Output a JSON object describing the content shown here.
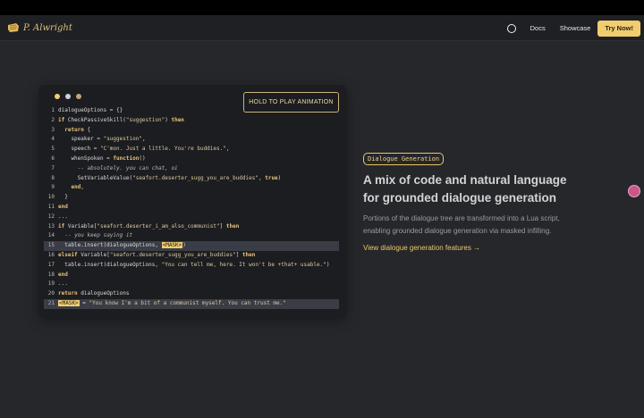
{
  "nav": {
    "logo_text": "P. Alwright",
    "links": [
      "Docs",
      "Showcase"
    ],
    "cta": "Try Now!"
  },
  "demo": {
    "hold_button": "HOLD TO PLAY ANIMATION",
    "dot_colors": [
      "#f1cd6f",
      "#cfd2d8",
      "#c7a27a"
    ],
    "code_lines": [
      {
        "n": "1",
        "segs": [
          {
            "t": "dialogueOptions = {}"
          }
        ]
      },
      {
        "n": "2",
        "segs": [
          {
            "t": "if",
            "c": "kw"
          },
          {
            "t": " CheckPassiveSkill("
          },
          {
            "t": "\"suggestion\"",
            "c": "str"
          },
          {
            "t": ") "
          },
          {
            "t": "then",
            "c": "kw"
          }
        ]
      },
      {
        "n": "3",
        "segs": [
          {
            "t": "  "
          },
          {
            "t": "return",
            "c": "kw"
          },
          {
            "t": " {"
          }
        ]
      },
      {
        "n": "4",
        "segs": [
          {
            "t": "    speaker = "
          },
          {
            "t": "\"suggestion\"",
            "c": "str"
          },
          {
            "t": ","
          }
        ]
      },
      {
        "n": "5",
        "segs": [
          {
            "t": "    speech = "
          },
          {
            "t": "\"C'mon. Just a little. You're buddies.\"",
            "c": "str"
          },
          {
            "t": ","
          }
        ]
      },
      {
        "n": "6",
        "segs": [
          {
            "t": "    whenSpoken = "
          },
          {
            "t": "function",
            "c": "kw"
          },
          {
            "t": "()"
          }
        ]
      },
      {
        "n": "7",
        "segs": [
          {
            "t": "      "
          },
          {
            "t": "-- absolutely. you can chat, oi",
            "c": "cm"
          }
        ]
      },
      {
        "n": "8",
        "segs": [
          {
            "t": "      SetVariableValue("
          },
          {
            "t": "\"seafort.deserter_sugg_you_are_buddies\"",
            "c": "str"
          },
          {
            "t": ", "
          },
          {
            "t": "true",
            "c": "kw"
          },
          {
            "t": ")"
          }
        ]
      },
      {
        "n": "9",
        "segs": [
          {
            "t": "    "
          },
          {
            "t": "end",
            "c": "kw"
          },
          {
            "t": ","
          }
        ]
      },
      {
        "n": "10",
        "segs": [
          {
            "t": "  }"
          }
        ]
      },
      {
        "n": "11",
        "segs": [
          {
            "t": "end",
            "c": "kw"
          }
        ]
      },
      {
        "n": "12",
        "segs": [
          {
            "t": "..."
          }
        ]
      },
      {
        "n": "13",
        "segs": [
          {
            "t": "if",
            "c": "kw"
          },
          {
            "t": " Variable["
          },
          {
            "t": "\"seafort.deserter_i_am_also_communist\"",
            "c": "str"
          },
          {
            "t": "] "
          },
          {
            "t": "then",
            "c": "kw"
          }
        ]
      },
      {
        "n": "14",
        "segs": [
          {
            "t": "  "
          },
          {
            "t": "-- you keep saying it",
            "c": "cm"
          }
        ]
      },
      {
        "n": "15",
        "hl": true,
        "segs": [
          {
            "t": "  table.insert(dialogueOptions, "
          },
          {
            "t": "<MASK>",
            "c": "mask"
          },
          {
            "t": ")"
          }
        ]
      },
      {
        "n": "16",
        "segs": [
          {
            "t": "elseif",
            "c": "kw"
          },
          {
            "t": " Variable["
          },
          {
            "t": "\"seafort.deserter_sugg_you_are_buddies\"",
            "c": "str"
          },
          {
            "t": "] "
          },
          {
            "t": "then",
            "c": "kw"
          }
        ]
      },
      {
        "n": "17",
        "segs": [
          {
            "t": "  table.insert(dialogueOptions, "
          },
          {
            "t": "\"You can tell me, here. It won't be +that+ usable.\"",
            "c": "str"
          },
          {
            "t": ")"
          }
        ]
      },
      {
        "n": "18",
        "segs": [
          {
            "t": "end",
            "c": "kw"
          }
        ]
      },
      {
        "n": "19",
        "segs": [
          {
            "t": "..."
          }
        ]
      },
      {
        "n": "20",
        "segs": [
          {
            "t": "return",
            "c": "kw"
          },
          {
            "t": " dialogueOptions"
          }
        ]
      },
      {
        "n": "21",
        "hl": true,
        "segs": [
          {
            "t": "<MASK>",
            "c": "mask"
          },
          {
            "t": " = "
          },
          {
            "t": "\"You know I'm a bit of a communist myself. You can trust me.\"",
            "c": "str"
          }
        ]
      }
    ]
  },
  "feature": {
    "badge": "Dialogue Generation",
    "title_line1": "A mix of code and natural language",
    "title_line2": "for grounded dialogue generation",
    "desc_line1": "Portions of the dialogue tree are transformed into a Lua script,",
    "desc_line2": "enabling grounded dialogue generation via masked infilling.",
    "link": "View dialogue generation features →"
  },
  "colors": {
    "accent": "#f1cd6f",
    "background": "#26272b",
    "navbar": "#1f2023",
    "code_card": "#1c1d20"
  }
}
